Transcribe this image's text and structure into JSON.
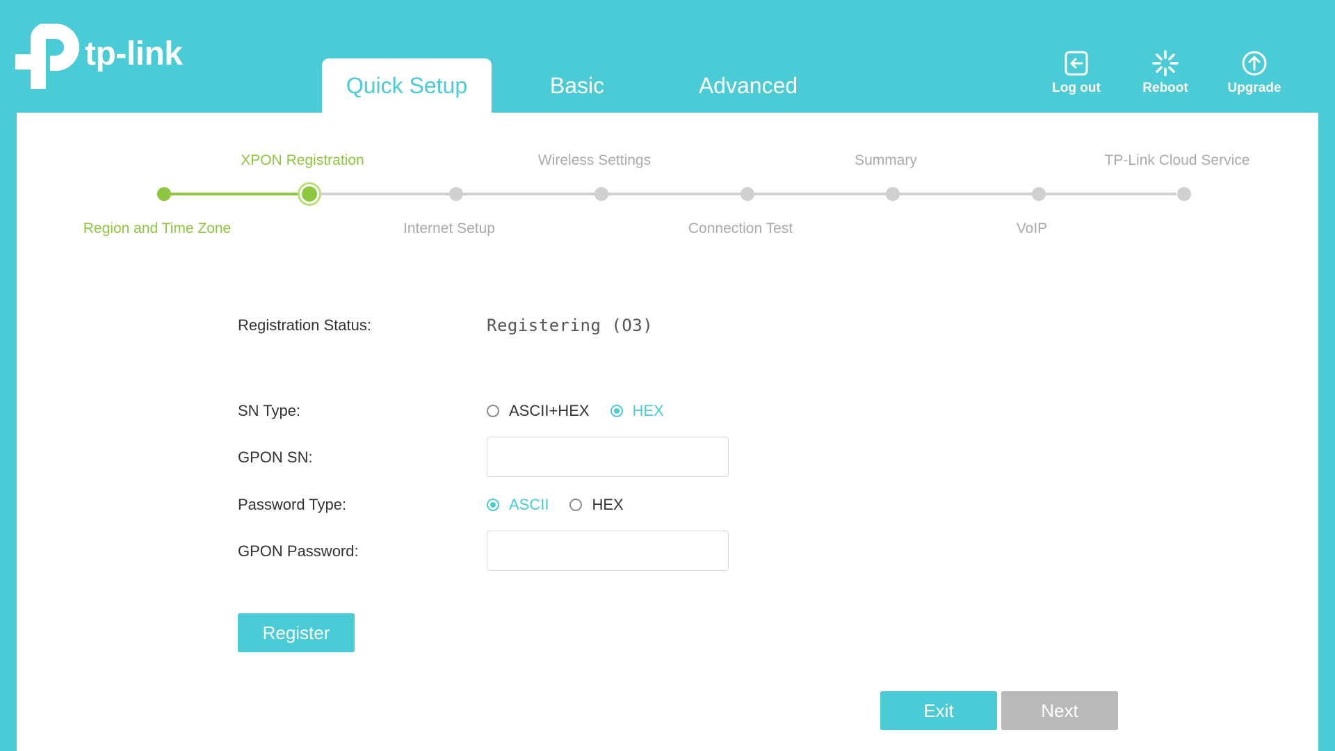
{
  "brand": {
    "name": "tp-link",
    "accent": "#4acbd6",
    "step_color": "#8dc63f"
  },
  "tabs": [
    {
      "label": "Quick Setup",
      "active": true
    },
    {
      "label": "Basic",
      "active": false
    },
    {
      "label": "Advanced",
      "active": false
    }
  ],
  "header_actions": {
    "logout": {
      "label": "Log out",
      "icon": "logout-icon"
    },
    "reboot": {
      "label": "Reboot",
      "icon": "reboot-icon"
    },
    "upgrade": {
      "label": "Upgrade",
      "icon": "upgrade-icon"
    }
  },
  "steps": [
    {
      "label": "Region and Time Zone",
      "state": "done"
    },
    {
      "label": "XPON Registration",
      "state": "current"
    },
    {
      "label": "Internet Setup",
      "state": "pending"
    },
    {
      "label": "Wireless Settings",
      "state": "pending"
    },
    {
      "label": "Connection Test",
      "state": "pending"
    },
    {
      "label": "Summary",
      "state": "pending"
    },
    {
      "label": "VoIP",
      "state": "pending"
    },
    {
      "label": "TP-Link Cloud Service",
      "state": "pending"
    }
  ],
  "form": {
    "registration_status_label": "Registration Status:",
    "registration_status_value": "Registering (O3)",
    "sn_type_label": "SN Type:",
    "sn_type_options": [
      {
        "label": "ASCII+HEX",
        "checked": false
      },
      {
        "label": "HEX",
        "checked": true
      }
    ],
    "gpon_sn_label": "GPON SN:",
    "gpon_sn_value": "",
    "password_type_label": "Password Type:",
    "password_type_options": [
      {
        "label": "ASCII",
        "checked": true
      },
      {
        "label": "HEX",
        "checked": false
      }
    ],
    "gpon_password_label": "GPON Password:",
    "gpon_password_value": ""
  },
  "buttons": {
    "register": "Register",
    "exit": "Exit",
    "next": "Next"
  }
}
